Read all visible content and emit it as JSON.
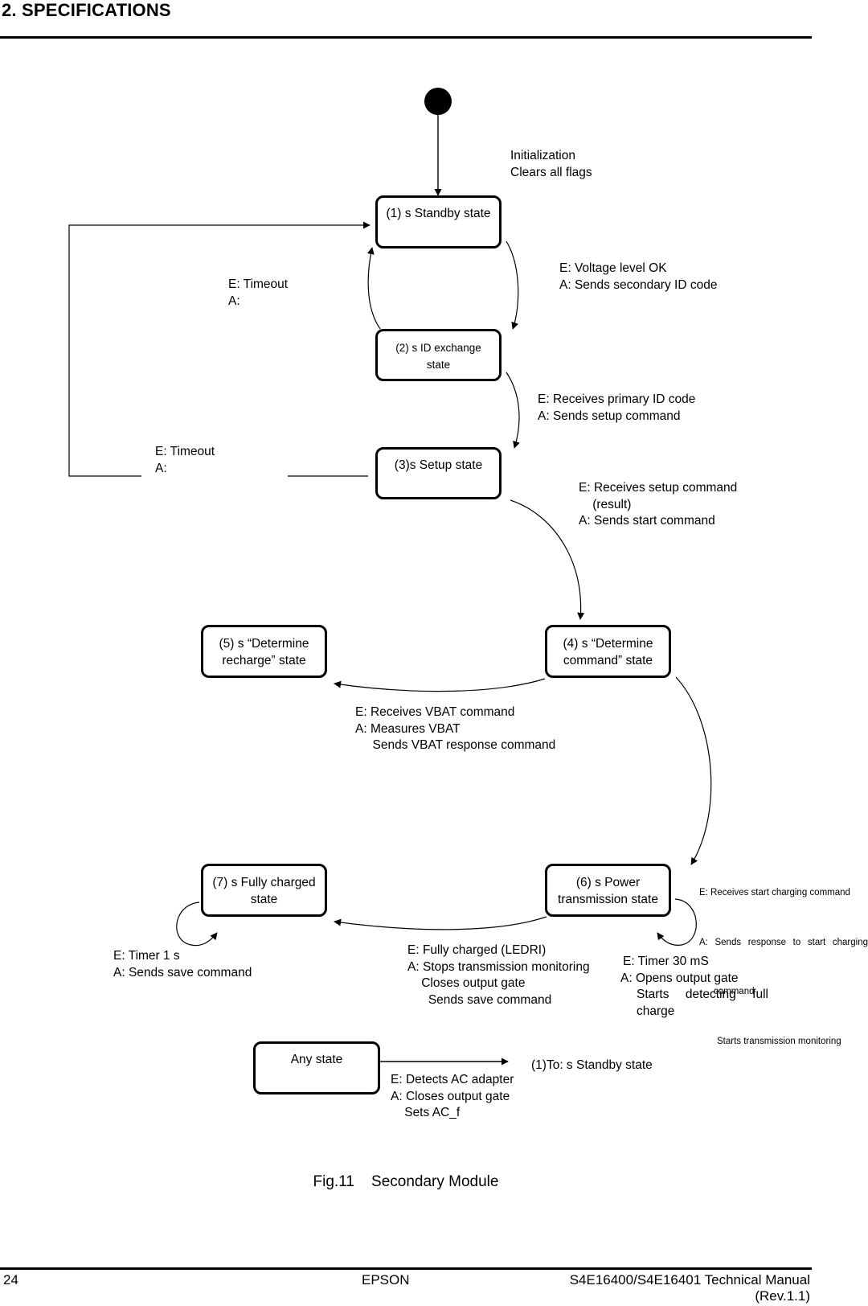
{
  "header": {
    "section_title": "2. SPECIFICATIONS"
  },
  "diagram": {
    "title": "Fig.11    Secondary Module",
    "initial": {
      "label_lines": [
        "Initialization",
        "Clears all flags"
      ]
    },
    "states": [
      {
        "id": 1,
        "label": "(1) s Standby state"
      },
      {
        "id": 2,
        "label": "(2) s ID exchange\nstate"
      },
      {
        "id": 3,
        "label": "(3)s Setup state"
      },
      {
        "id": 4,
        "label": "(4) s “Determine\ncommand” state"
      },
      {
        "id": 5,
        "label": "(5) s “Determine\nrecharge” state"
      },
      {
        "id": 6,
        "label": "(6) s Power\ntransmission state"
      },
      {
        "id": 7,
        "label": "(7) s Fully charged\nstate"
      },
      {
        "id": "any",
        "label": "Any state"
      }
    ],
    "transitions": [
      {
        "from": 1,
        "to": 2,
        "event": "E: Voltage level OK",
        "action": "A: Sends secondary ID code"
      },
      {
        "from": 2,
        "to": 1,
        "event": "E: Timeout",
        "action": "A:"
      },
      {
        "from": 2,
        "to": 3,
        "event": "E: Receives primary ID code",
        "action": "A: Sends setup command"
      },
      {
        "from": 3,
        "to": 1,
        "event": "E: Timeout",
        "action": "A:"
      },
      {
        "from": 3,
        "to": 4,
        "event": "E: Receives setup command\n    (result)",
        "action": "A: Sends start command"
      },
      {
        "from": 4,
        "to": 5,
        "event": "E: Receives VBAT command",
        "action": "A: Measures VBAT\n     Sends VBAT response command"
      },
      {
        "from": 4,
        "to": 6,
        "event": "E: Receives start charging command",
        "action_lines": [
          "A:  Sends  response  to  start  charging",
          "command",
          "Starts transmission monitoring"
        ]
      },
      {
        "from": 6,
        "to": 7,
        "event": "E: Fully charged (LEDRI)",
        "action": "A: Stops transmission monitoring\n    Closes output gate\n      Sends save command"
      },
      {
        "from": 6,
        "to": 6,
        "event": "E: Timer 30 mS",
        "action_lines": [
          "A: Opens output gate",
          "Starts    detecting    full",
          "charge"
        ]
      },
      {
        "from": 7,
        "to": 7,
        "event": "E: Timer 1 s",
        "action": "A: Sends save command"
      },
      {
        "from": "any",
        "to": 1,
        "event": "E: Detects AC adapter",
        "action": "A: Closes output gate\n    Sets AC_f",
        "target_label": "(1)To: s Standby state"
      }
    ]
  },
  "footer": {
    "page_number": "24",
    "brand": "EPSON",
    "doc_title": "S4E16400/S4E16401 Technical Manual",
    "revision": "(Rev.1.1)"
  }
}
